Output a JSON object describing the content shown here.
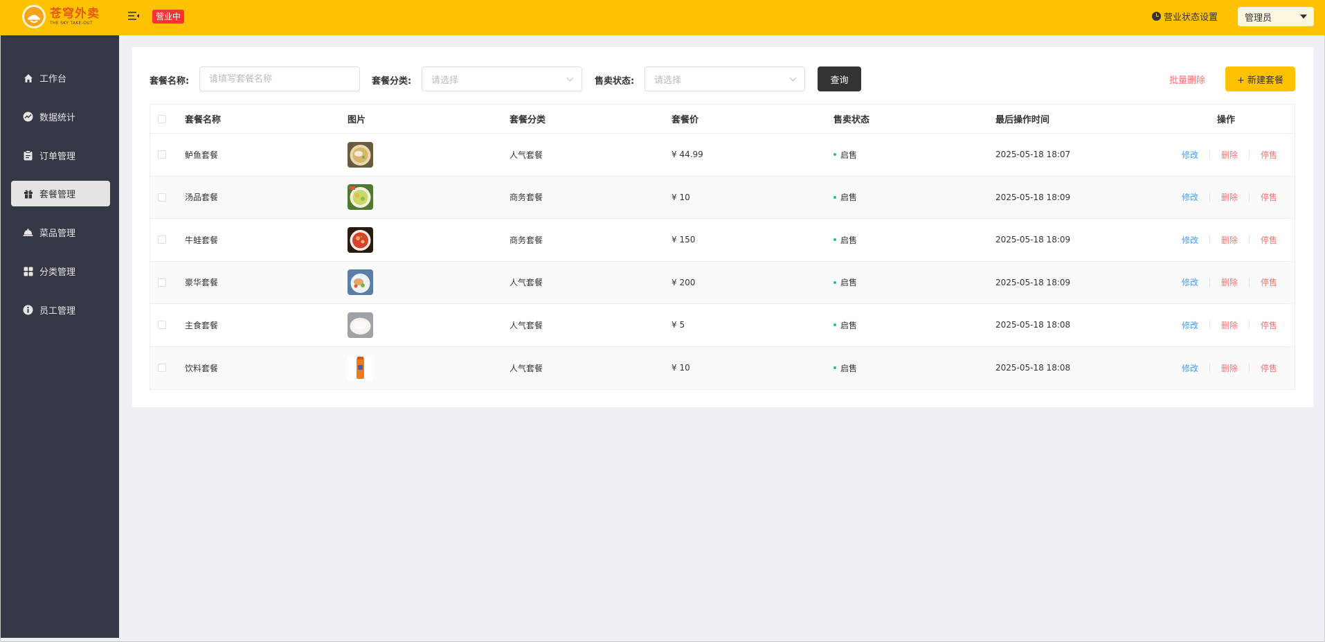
{
  "header": {
    "logo_title": "苍穹外卖",
    "logo_subtitle": "THE SKY TAKE-OUT",
    "shop_status": "营业中",
    "shop_status_setting": "营业状态设置",
    "user_name": "管理员",
    "accent_color": "#ffc200"
  },
  "sidebar": {
    "items": [
      {
        "label": "工作台",
        "icon": "home-icon"
      },
      {
        "label": "数据统计",
        "icon": "chart-icon"
      },
      {
        "label": "订单管理",
        "icon": "clipboard-icon"
      },
      {
        "label": "套餐管理",
        "icon": "gift-icon",
        "active": true
      },
      {
        "label": "菜品管理",
        "icon": "dish-icon"
      },
      {
        "label": "分类管理",
        "icon": "grid-icon"
      },
      {
        "label": "员工管理",
        "icon": "info-icon"
      }
    ]
  },
  "filters": {
    "name_label": "套餐名称:",
    "name_placeholder": "请填写套餐名称",
    "category_label": "套餐分类:",
    "category_placeholder": "请选择",
    "status_label": "售卖状态:",
    "status_placeholder": "请选择",
    "query_button": "查询",
    "batch_delete": "批量删除",
    "new_button": "+ 新建套餐"
  },
  "table": {
    "columns": [
      "套餐名称",
      "图片",
      "套餐分类",
      "套餐价",
      "售卖状态",
      "最后操作时间",
      "操作"
    ],
    "actions": {
      "edit": "修改",
      "delete": "删除",
      "stop": "停售"
    },
    "rows": [
      {
        "name": "鲈鱼套餐",
        "category": "人气套餐",
        "price": "¥ 44.99",
        "status": "启售",
        "updated": "2025-05-18 18:07",
        "image": "soup-bowl"
      },
      {
        "name": "汤品套餐",
        "category": "商务套餐",
        "price": "¥ 10",
        "status": "启售",
        "updated": "2025-05-18 18:09",
        "image": "veggie-soup"
      },
      {
        "name": "牛蛙套餐",
        "category": "商务套餐",
        "price": "¥ 150",
        "status": "启售",
        "updated": "2025-05-18 18:09",
        "image": "spicy-dish"
      },
      {
        "name": "豪华套餐",
        "category": "人气套餐",
        "price": "¥ 200",
        "status": "启售",
        "updated": "2025-05-18 18:09",
        "image": "mixed-plate"
      },
      {
        "name": "主食套餐",
        "category": "人气套餐",
        "price": "¥ 5",
        "status": "启售",
        "updated": "2025-05-18 18:08",
        "image": "bun"
      },
      {
        "name": "饮料套餐",
        "category": "人气套餐",
        "price": "¥ 10",
        "status": "启售",
        "updated": "2025-05-18 18:08",
        "image": "drink-bottle"
      }
    ]
  }
}
